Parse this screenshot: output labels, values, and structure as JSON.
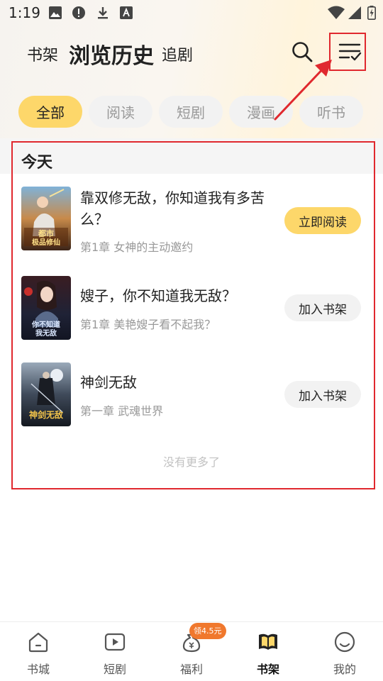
{
  "status_bar": {
    "time": "1:19",
    "left_icons": [
      "image-icon",
      "alert-circle-icon",
      "download-icon",
      "font-icon"
    ],
    "right_icons": [
      "wifi-icon",
      "signal-icon",
      "battery-charging-icon"
    ]
  },
  "header": {
    "tabs": [
      {
        "label": "书架",
        "active": false
      },
      {
        "label": "浏览历史",
        "active": true
      },
      {
        "label": "追剧",
        "active": false
      }
    ],
    "search_icon": "search-icon",
    "menu_icon": "edit-list-icon"
  },
  "filters": [
    {
      "label": "全部",
      "active": true
    },
    {
      "label": "阅读",
      "active": false
    },
    {
      "label": "短剧",
      "active": false
    },
    {
      "label": "漫画",
      "active": false
    },
    {
      "label": "听书",
      "active": false
    }
  ],
  "section": {
    "title": "今天"
  },
  "books": [
    {
      "title": "靠双修无敌，你知道我有多苦么？",
      "chapter": "第1章 女神的主动邀约",
      "action": "立即阅读",
      "cover_text": "都市极品修仙"
    },
    {
      "title": "嫂子，你不知道我无敌？",
      "chapter": "第1章 美艳嫂子看不起我？",
      "action": "加入书架",
      "cover_text": "你不知道我无敌"
    },
    {
      "title": "神剑无敌",
      "chapter": "第一章 武魂世界",
      "action": "加入书架",
      "cover_text": "神剑无敌"
    }
  ],
  "no_more": "没有更多了",
  "bottom_nav": {
    "items": [
      {
        "label": "书城",
        "icon": "home-icon",
        "active": false
      },
      {
        "label": "短剧",
        "icon": "play-icon",
        "active": false
      },
      {
        "label": "福利",
        "icon": "money-bag-icon",
        "active": false
      },
      {
        "label": "书架",
        "icon": "book-icon",
        "active": true
      },
      {
        "label": "我的",
        "icon": "smile-icon",
        "active": false
      }
    ],
    "badge": "领4.5元"
  },
  "colors": {
    "accent": "#fdd76a",
    "annotation": "#e0282e",
    "badge": "#f0782d",
    "muted_text": "#999999"
  }
}
